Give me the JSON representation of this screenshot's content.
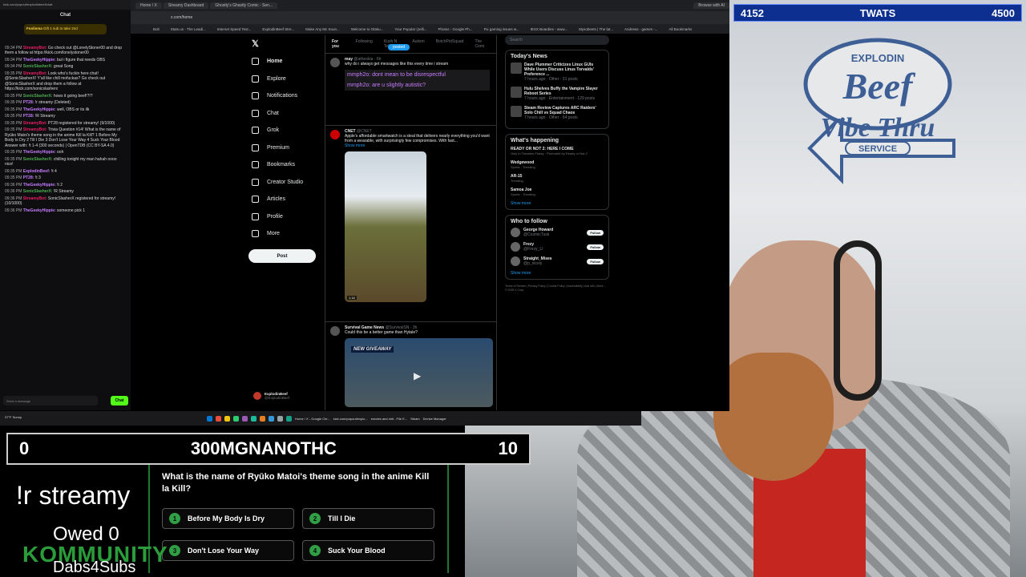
{
  "browser": {
    "tabs": [
      "Home / X",
      "Streamy Dashboard",
      "Ghostly's Ghastly Comic - Sen...",
      "Browse with AI"
    ],
    "address": "x.com/home",
    "bookmarks": [
      "Bolt",
      "Stats.us - The Leadi...",
      "Internet Speed Test...",
      "ExplodinBeef Stre...",
      "Make Any Mc Soun...",
      "Welcome to Otaku...",
      "Your Popular (Jelli...",
      "Photos - Google Ph...",
      "Fix gaming issues w...",
      "IESX Boardies - www...",
      "Mysobeets | The lat...",
      "Andrews - games -...",
      "All Bookmarks"
    ]
  },
  "chat": {
    "url": "kick.com/popout/explodinbeef/chat",
    "title": "Chat",
    "pinned_user": "Foolisma",
    "pinned_msg": "Gift 1 sub to take 2nd",
    "lines": [
      {
        "time": "09:34 PM",
        "user": "StreamyBot",
        "color": "#e91e63",
        "text": "Go check out @LonelyStoner00 and drop them a follow at https://kick.com/lonelystoner00"
      },
      {
        "time": "09:34 PM",
        "user": "TheGeekyHippie",
        "color": "#c77dff",
        "text": "but i figure that needs OBS"
      },
      {
        "time": "09:34 PM",
        "user": "SonicSlasherX",
        "color": "#4caf50",
        "text": "great Song"
      },
      {
        "time": "09:35 PM",
        "user": "StreamyBot",
        "color": "#e91e63",
        "text": "Look who's fuckin here chat! @SonicSlasherX! Y'all like chill mofuckas? Go check out @SonicSlasherX and drop them a follow at https://kick.com/sonicslasherx"
      },
      {
        "time": "09:35 PM",
        "user": "SonicSlasherX",
        "color": "#4caf50",
        "text": "hows it going beef!?!?"
      },
      {
        "time": "09:35 PM",
        "user": "PT28",
        "color": "#c77dff",
        "text": "!r streamy (Deleted)"
      },
      {
        "time": "09:35 PM",
        "user": "TheGeekyHippie",
        "color": "#c77dff",
        "text": "well, OBS or its ilk"
      },
      {
        "time": "09:35 PM",
        "user": "PT28",
        "color": "#c77dff",
        "text": "!R Streamy"
      },
      {
        "time": "09:35 PM",
        "user": "StreamyBot",
        "color": "#e91e63",
        "text": "PT28 registered for streamy! (9/1000)"
      },
      {
        "time": "09:35 PM",
        "user": "StreamyBot",
        "color": "#e91e63",
        "text": "Trivia Question #14! What is the name of Ryūko Matoi's theme song in the anime Kill la Kill? 1 Before My Body Is Dry 2 Till I Die 3 Don't Lose Your Way 4 Suck Your Blood Answer with: !t 1-4 (300 seconds) | OpenTDB (CC BY-SA 4.0)"
      },
      {
        "time": "09:35 PM",
        "user": "TheGeekyHippie",
        "color": "#c77dff",
        "text": "ooh"
      },
      {
        "time": "09:35 PM",
        "user": "SonicSlasherX",
        "color": "#4caf50",
        "text": "chilling tonight my man hahah oooo nice!"
      },
      {
        "time": "09:35 PM",
        "user": "ExplodinBeef",
        "color": "#c77dff",
        "text": "!t 4"
      },
      {
        "time": "09:35 PM",
        "user": "PT28",
        "color": "#c77dff",
        "text": "!t 3"
      },
      {
        "time": "09:36 PM",
        "user": "TheGeekyHippie",
        "color": "#c77dff",
        "text": "!t 2"
      },
      {
        "time": "09:36 PM",
        "user": "SonicSlasherX",
        "color": "#4caf50",
        "text": "!R Streamy"
      },
      {
        "time": "09:36 PM",
        "user": "StreamyBot",
        "color": "#e91e63",
        "text": "SonicSlasherX registered for streamy! (10/1000)"
      },
      {
        "time": "09:36 PM",
        "user": "TheGeekyHippie",
        "color": "#c77dff",
        "text": "someone pick 1"
      }
    ],
    "input_placeholder": "Send a message",
    "send_label": "Chat"
  },
  "x": {
    "nav": [
      "Home",
      "Explore",
      "Notifications",
      "Chat",
      "Grok",
      "Premium",
      "Bookmarks",
      "Creator Studio",
      "Articles",
      "Profile",
      "More"
    ],
    "post_label": "Post",
    "account_name": "ExplodinBeef",
    "account_handle": "@ExplodinBeef",
    "feed_tabs": [
      "For you",
      "Following",
      "Kush N Tell",
      "Autism",
      "BotchPotSquad",
      "The Comi"
    ],
    "posted_pill": "posted",
    "tweets": [
      {
        "name": "may",
        "handle": "@atheokia · 6h",
        "text": "why do i always get messages like this every time i stream",
        "quote1": "mmph2o: dont mean to be disrespectful",
        "quote2": "mmph2o: are u slightly autistic?"
      },
      {
        "name": "CNET",
        "handle": "@CNET",
        "text": "Apple's affordable smartwatch is a steal that delivers nearly everything you'd want from a wearable, with surprisingly few compromises. With fast...",
        "show_more": "Show more",
        "duration": "1:18"
      },
      {
        "name": "Survival Game News",
        "handle": "@SurvivalSN · 3h",
        "text": "Could this be a better game than Hytale?",
        "badge": "NEW GIVEAWAY"
      }
    ],
    "search_placeholder": "Search",
    "todays_news": {
      "title": "Today's News",
      "items": [
        {
          "headline": "Dave Plummer Criticizes Linux GUIs While Users Discuss Linus Torvalds' Preference ...",
          "meta": "7 hours ago · Other · 31 posts"
        },
        {
          "headline": "Hulu Shelves Buffy the Vampire Slayer Reboot Series",
          "meta": "7 hours ago · Entertainment · 129 posts"
        },
        {
          "headline": "Steam Review Captures ARC Raiders' Solo Chill vs Squad Chaos",
          "meta": "7 hours ago · Other · 64 posts"
        }
      ]
    },
    "happening": {
      "title": "What's happening",
      "items": [
        {
          "label": "READY OR NOT 2: HERE I COME",
          "meta": "Only in Theaters Friday · Promoted by Ready or Not 2"
        },
        {
          "label": "Wedgewood",
          "meta": "Sports · Trending"
        },
        {
          "label": "AR-15",
          "meta": "Trending"
        },
        {
          "label": "Samoa Joe",
          "meta": "Sports · Trending"
        }
      ],
      "show_more": "Show more"
    },
    "who_to_follow": {
      "title": "Who to follow",
      "people": [
        {
          "name": "George Howard",
          "handle": "@CosmicTusk"
        },
        {
          "name": "Frezy",
          "handle": "@Frezy_U"
        },
        {
          "name": "Straight_Mises",
          "handle": "@p_nicely"
        }
      ],
      "follow_label": "Follow",
      "show_more": "Show more"
    },
    "footer": "Terms of Service | Privacy Policy | Cookie Policy | Accessibility | Ads info | More ... © 2025 X Corp."
  },
  "overlay": {
    "top_left_score": "4152",
    "top_title": "TWATS",
    "top_right_score": "4500",
    "scoreboard_left": "0",
    "scoreboard_title": "300MGNANOTHC",
    "scoreboard_right": "10",
    "command": "!r streamy",
    "owed": "Owed 0",
    "kommunity": "KOMMUNITY",
    "dabs": "Dabs4Subs",
    "quiz": {
      "question": "What is the name of Ryūko Matoi's theme song in the anime Kill la Kill?",
      "answers": [
        {
          "num": "1",
          "label": "Before My Body Is Dry"
        },
        {
          "num": "2",
          "label": "Till I Die"
        },
        {
          "num": "3",
          "label": "Don't Lose Your Way"
        },
        {
          "num": "4",
          "label": "Suck Your Blood"
        }
      ]
    },
    "logo": {
      "top": "EXPLODIN",
      "main": "Beef",
      "sub": "Vibe Thru",
      "band": "SERVICE"
    }
  },
  "taskbar": {
    "weather": "37°F Sunny",
    "items": [
      "Home / X - Google Chr...",
      "kick.com/popout/explo...",
      "emotes and shit - File E...",
      "Steam",
      "Device Manager"
    ]
  },
  "colors": {
    "green": "#2f9e44",
    "blue_bar": "#0d2f8f",
    "kick_green": "#53fc18"
  }
}
